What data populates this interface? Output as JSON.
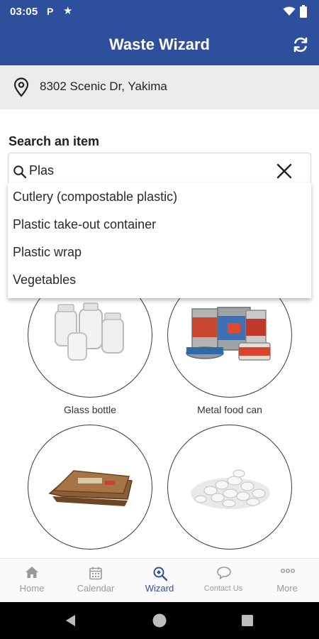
{
  "status_bar": {
    "time": "03:05",
    "icons": [
      "parking-icon",
      "star-icon",
      "wifi-icon",
      "battery-icon"
    ]
  },
  "app_bar": {
    "title": "Waste Wizard",
    "action_icon": "refresh-icon"
  },
  "address": {
    "text": "8302 Scenic Dr, Yakima",
    "icon": "location-pin-icon"
  },
  "search": {
    "label": "Search an item",
    "value": "Plas",
    "suggestions": [
      "Cutlery (compostable plastic)",
      "Plastic take-out container",
      "Plastic wrap",
      "Vegetables"
    ]
  },
  "items": [
    {
      "label": "Glass bottle",
      "image": "glass-jars"
    },
    {
      "label": "Metal food can",
      "image": "metal-cans"
    },
    {
      "label": "",
      "image": "flattened-cardboard"
    },
    {
      "label": "",
      "image": "packing-peanuts"
    }
  ],
  "bottom_nav": [
    {
      "label": "Home",
      "icon": "home-icon",
      "active": false
    },
    {
      "label": "Calendar",
      "icon": "calendar-icon",
      "active": false
    },
    {
      "label": "Wizard",
      "icon": "wizard-search-icon",
      "active": true
    },
    {
      "label": "Contact Us",
      "icon": "chat-icon",
      "active": false
    },
    {
      "label": "More",
      "icon": "more-icon",
      "active": false
    }
  ],
  "colors": {
    "brand": "#2d4f9c",
    "active_nav": "#2d4f9c",
    "inactive_nav": "#9a9a9a"
  }
}
